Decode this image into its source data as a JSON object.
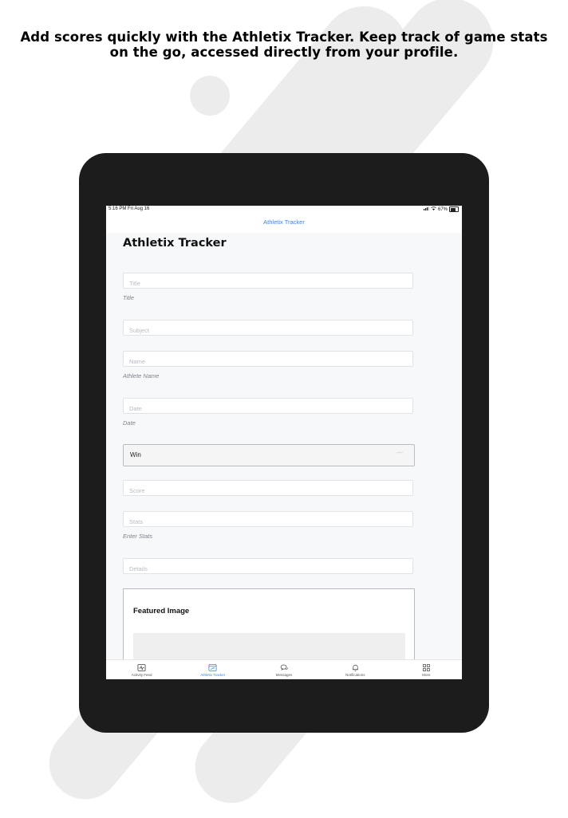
{
  "headline": {
    "line1": "Add scores quickly with the Athletix Tracker.  Keep track of game stats",
    "line2": "on the go, accessed directly from your profile."
  },
  "statusbar": {
    "time": "5:16 PM   Fri Aug 16",
    "battery": "67%"
  },
  "navbar": {
    "title": "Athletix Tracker"
  },
  "page": {
    "title": "Athletix Tracker"
  },
  "form": {
    "title": {
      "placeholder": "Title",
      "helper": "Title"
    },
    "subject": {
      "placeholder": "Subject"
    },
    "name": {
      "placeholder": "Name",
      "helper": "Athlete Name"
    },
    "date": {
      "placeholder": "Date",
      "helper": "Date"
    },
    "result": {
      "value": "Win",
      "chevron": "—"
    },
    "score": {
      "placeholder": "Score"
    },
    "stats": {
      "placeholder": "Stats",
      "helper": "Enter Stats"
    },
    "details": {
      "placeholder": "Details"
    }
  },
  "featured": {
    "title": "Featured Image"
  },
  "tabbar": {
    "active_color": "#3b82f6",
    "items": [
      {
        "label": "Activity Feed",
        "icon": "activity-icon"
      },
      {
        "label": "Athletix Tracker",
        "icon": "tracker-icon"
      },
      {
        "label": "Messages",
        "icon": "messages-icon"
      },
      {
        "label": "Notifications",
        "icon": "bell-icon"
      },
      {
        "label": "More",
        "icon": "grid-icon"
      }
    ]
  }
}
